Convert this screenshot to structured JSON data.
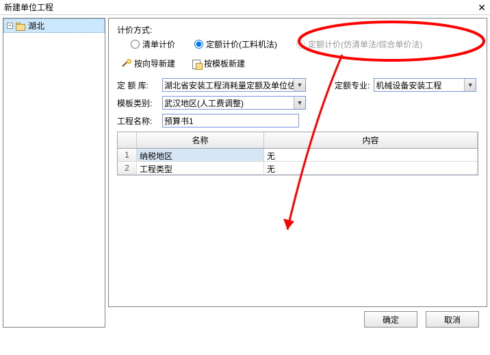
{
  "title": "新建单位工程",
  "tree": {
    "root": "湖北"
  },
  "form": {
    "pricing_label": "计价方式:",
    "modes": {
      "bill": "清单计价",
      "quota_machine": "定额计价(工料机法)",
      "quota_sim": "定额计价(仿清单法/综合单价法)"
    },
    "wiz_new": "按向导新建",
    "tmpl_new": "按模板新建",
    "quota_lib_label": "定 额 库",
    "quota_lib_value": "湖北省安装工程消耗量定额及单位估价表",
    "quota_spec_label": "定额专业:",
    "quota_spec_value": "机械设备安装工程",
    "template_cat_label": "模板类别:",
    "template_cat_value": "武汉地区(人工费调整)",
    "proj_name_label": "工程名称:",
    "proj_name_value": "预算书1"
  },
  "grid": {
    "col_name": "名称",
    "col_content": "内容",
    "rows": [
      {
        "idx": "1",
        "name": "纳税地区",
        "content": "无"
      },
      {
        "idx": "2",
        "name": "工程类型",
        "content": "无"
      }
    ]
  },
  "buttons": {
    "ok": "确定",
    "cancel": "取消"
  }
}
